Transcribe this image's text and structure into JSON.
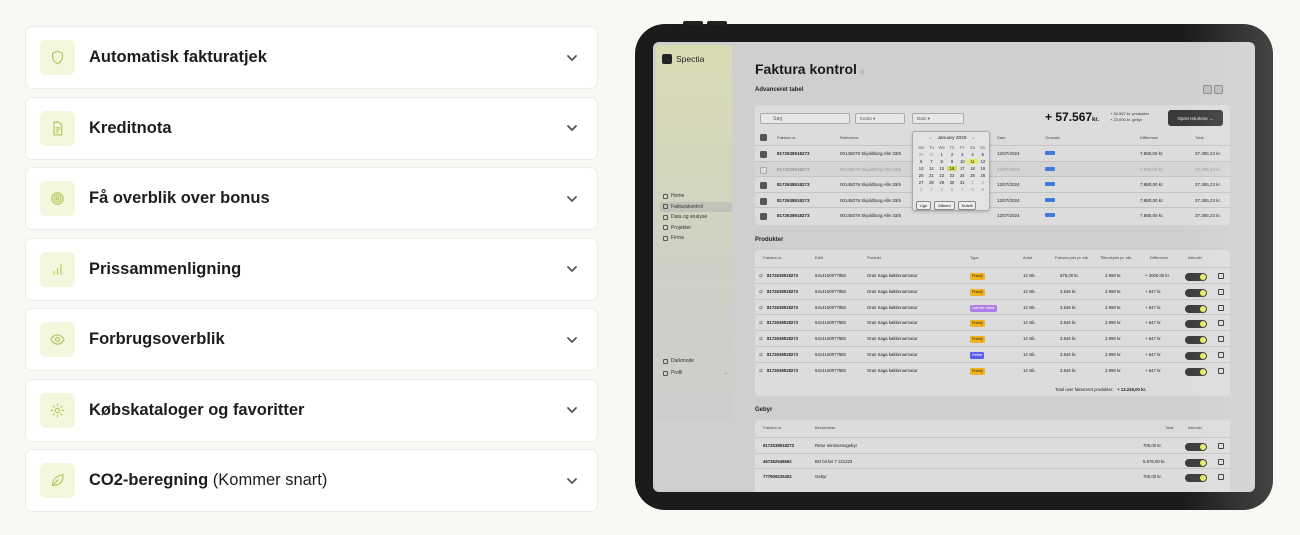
{
  "accordion": {
    "items": [
      {
        "title": "Automatisk fakturatjek",
        "suffix": "",
        "icon": "shield-icon"
      },
      {
        "title": "Kreditnota",
        "suffix": "",
        "icon": "document-icon"
      },
      {
        "title": "Få overblik over bonus",
        "suffix": "",
        "icon": "target-icon"
      },
      {
        "title": "Prissammenligning",
        "suffix": "",
        "icon": "bar-chart-icon"
      },
      {
        "title": "Forbrugsoverblik",
        "suffix": "",
        "icon": "eye-icon"
      },
      {
        "title": "Købskataloger og favoritter",
        "suffix": "",
        "icon": "gear-icon"
      },
      {
        "title": "CO2-beregning",
        "suffix": "(Kommer snart)",
        "icon": "leaf-icon"
      }
    ],
    "icon_color": "#b7c45a",
    "icon_bg": "#f3f7dd"
  },
  "app": {
    "brand": "Spectia",
    "nav": [
      "Home",
      "Fakturakontrol",
      "Data og analyse",
      "Projekter",
      "Firma"
    ],
    "active_nav": "Fakturakontrol",
    "bottom": {
      "darkmode": "Darkmode",
      "profile": "Profil"
    },
    "title": "Faktura kontrol",
    "subtitle": "Advanceret tabel",
    "search_placeholder": "Søg",
    "filters": [
      "Konto",
      "Dato"
    ],
    "total": "+ 57.567",
    "total_unit": "kr.",
    "total_notes": [
      "+ 34.567 kr. produkter",
      "+ 23.000 kr. gebyr"
    ],
    "return_button": "Opret returkrav",
    "invoice_columns": [
      "Faktura nr.",
      "Reference",
      "Dato",
      "Grossist",
      "Difference",
      "Total"
    ],
    "invoices": [
      {
        "nr": "8172638918273",
        "ref": "00145079 Skjoldborg Alle 33/5",
        "date": "12/07/2024",
        "diff": "7.880,00 kr.",
        "total": "37.385,23 kr.",
        "checked": true,
        "dim": false
      },
      {
        "nr": "8172638918273",
        "ref": "00145079 Skjoldborg Alle 33/5",
        "date": "12/07/2024",
        "diff": "7.880,00 kr.",
        "total": "37.385,23 kr.",
        "checked": false,
        "dim": true
      },
      {
        "nr": "8172638918273",
        "ref": "00145079 Skjoldborg Alle 33/5",
        "date": "12/07/2024",
        "diff": "7.880,00 kr.",
        "total": "37.385,23 kr.",
        "checked": true,
        "dim": false
      },
      {
        "nr": "8172638918273",
        "ref": "00145079 Skjoldborg Alle 33/5",
        "date": "12/07/2024",
        "diff": "7.880,00 kr.",
        "total": "37.385,23 kr.",
        "checked": true,
        "dim": false
      },
      {
        "nr": "8172638918273",
        "ref": "00145079 Skjoldborg Alle 33/5",
        "date": "12/07/2024",
        "diff": "7.880,00 kr.",
        "total": "37.385,23 kr.",
        "checked": true,
        "dim": false
      }
    ],
    "calendar": {
      "month": "January 2025",
      "weekdays": [
        "Mo",
        "Tu",
        "We",
        "Th",
        "Fr",
        "Sa",
        "Su"
      ],
      "days": [
        "30",
        "31",
        "1",
        "2",
        "3",
        "4",
        "5",
        "6",
        "7",
        "8",
        "9",
        "10",
        "11",
        "12",
        "13",
        "14",
        "15",
        "16",
        "17",
        "18",
        "19",
        "20",
        "21",
        "22",
        "23",
        "24",
        "25",
        "26",
        "27",
        "28",
        "29",
        "30",
        "31",
        "1",
        "2",
        "3",
        "4",
        "5",
        "6",
        "7",
        "8",
        "9"
      ],
      "buttons": [
        "Uge",
        "Måned",
        "Nulstil"
      ]
    },
    "products_title": "Produkter",
    "product_columns": [
      "Faktura nr.",
      "EAN",
      "Produkt",
      "Type",
      "Antal",
      "Faktura pris pr. stk.",
      "Tilbudspris pr. stk.",
      "Difference",
      "Inkluder"
    ],
    "products": [
      {
        "nr": "8172638918273",
        "ean": "6414150077982",
        "name": "Oras Saga køkkenarmatur",
        "type": "Prisfejl",
        "type_color": "#f0b323",
        "qty": "12 stk.",
        "price": "675,00 kr.",
        "offer": "2.999 kr.",
        "diff": "+ 3000,00 kr."
      },
      {
        "nr": "8172638918273",
        "ean": "6414150077982",
        "name": "Oras Saga køkkenarmatur",
        "type": "Prisfejl",
        "type_color": "#f0b323",
        "qty": "12 stk.",
        "price": "3.546 kr.",
        "offer": "2.999 kr.",
        "diff": "+ 547 kr."
      },
      {
        "nr": "8172638918273",
        "ean": "6414150077982",
        "name": "Oras Saga køkkenarmatur",
        "type": "Udenfor aftale",
        "type_color": "#b07de8",
        "qty": "12 stk.",
        "price": "3.546 kr.",
        "offer": "2.999 kr.",
        "diff": "+ 547 kr."
      },
      {
        "nr": "8172638918273",
        "ean": "6414150077982",
        "name": "Oras Saga køkkenarmatur",
        "type": "Prisfejl",
        "type_color": "#f0b323",
        "qty": "12 stk.",
        "price": "3.546 kr.",
        "offer": "2.999 kr.",
        "diff": "+ 547 kr."
      },
      {
        "nr": "8172638918273",
        "ean": "6414150077982",
        "name": "Oras Saga køkkenarmatur",
        "type": "Prisfejl",
        "type_color": "#f0b323",
        "qty": "12 stk.",
        "price": "3.546 kr.",
        "offer": "2.999 kr.",
        "diff": "+ 547 kr."
      },
      {
        "nr": "8172638918273",
        "ean": "6414150077982",
        "name": "Oras Saga køkkenarmatur",
        "type": "Defekt",
        "type_color": "#5b5bf0",
        "qty": "12 stk.",
        "price": "3.546 kr.",
        "offer": "2.999 kr.",
        "diff": "+ 547 kr."
      },
      {
        "nr": "8172638918273",
        "ean": "6414150077982",
        "name": "Oras Saga køkkenarmatur",
        "type": "Prisfejl",
        "type_color": "#f0b323",
        "qty": "12 stk.",
        "price": "3.546 kr.",
        "offer": "2.999 kr.",
        "diff": "+ 547 kr."
      }
    ],
    "products_total_label": "Total over faktureret produkter:",
    "products_total": "+ 13.245,00 kr.",
    "fees_title": "Gebyr",
    "fee_columns": [
      "Faktura nr.",
      "Beskrivelse",
      "Total",
      "Inkluder"
    ],
    "fees": [
      {
        "nr": "8172638918273",
        "desc": "Retur minimumsgebyr",
        "total": "700,00 kr."
      },
      {
        "nr": "467362546662",
        "desc": "BO bil før 7 131223",
        "total": "5.876,00 kr."
      },
      {
        "nr": "777909235402",
        "desc": "Gebyr",
        "total": "700,00 kr."
      }
    ]
  }
}
